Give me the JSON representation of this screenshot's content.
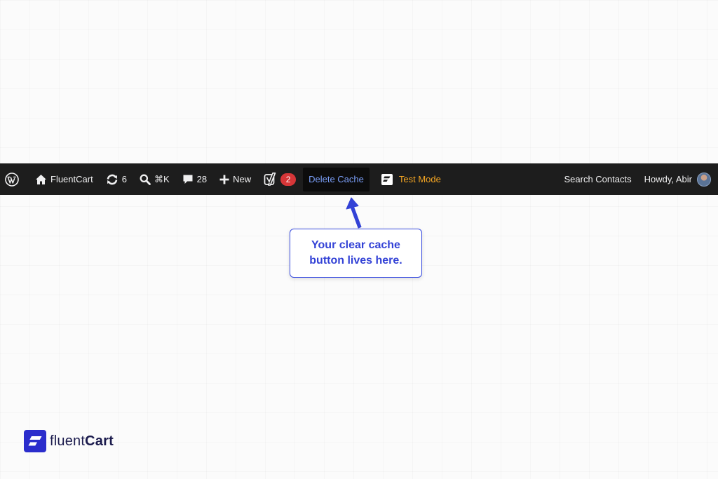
{
  "admin_bar": {
    "site_name": "FluentCart",
    "updates_count": "6",
    "search_shortcut": "⌘K",
    "comments_count": "28",
    "new_label": "New",
    "yoast_count": "2",
    "delete_cache_label": "Delete Cache",
    "test_mode_label": "Test Mode",
    "search_contacts_label": "Search Contacts",
    "howdy_label": "Howdy, Abir"
  },
  "callout": {
    "text": "Your clear cache\nbutton lives here."
  },
  "brand": {
    "light": "fluent",
    "bold": "Cart"
  },
  "colors": {
    "admin_bar_bg": "#1d1d1d",
    "delete_cache_text": "#7a9ef7",
    "test_mode_text": "#f5a623",
    "badge_red": "#d63638",
    "callout_blue": "#3342d6",
    "brand_blue": "#2b2dcc"
  },
  "icons": [
    "wordpress-icon",
    "home-icon",
    "updates-icon",
    "search-icon",
    "comment-icon",
    "plus-icon",
    "yoast-icon",
    "fluentcart-icon",
    "avatar"
  ]
}
